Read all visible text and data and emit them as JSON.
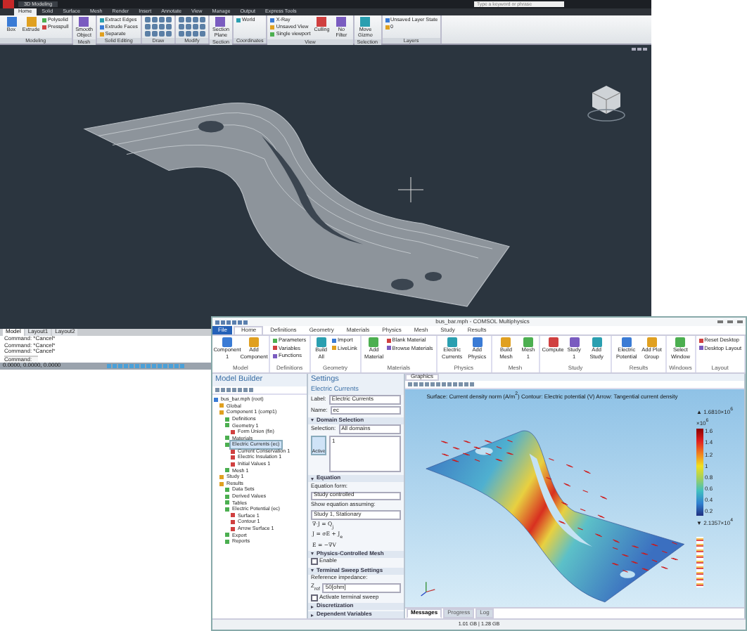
{
  "autocad": {
    "title": "3D Modeling",
    "search_placeholder": "Type a keyword or phrase",
    "tabs": [
      {
        "label": "Home",
        "selected": true
      },
      {
        "label": "Solid",
        "selected": false
      },
      {
        "label": "Surface",
        "selected": false
      },
      {
        "label": "Mesh",
        "selected": false
      },
      {
        "label": "Render",
        "selected": false
      },
      {
        "label": "Insert",
        "selected": false
      },
      {
        "label": "Annotate",
        "selected": false
      },
      {
        "label": "View",
        "selected": false
      },
      {
        "label": "Manage",
        "selected": false
      },
      {
        "label": "Output",
        "selected": false
      },
      {
        "label": "Express Tools",
        "selected": false
      }
    ],
    "panels": [
      {
        "label": "Modeling",
        "tools": [
          {
            "kind": "large",
            "label": "Box"
          },
          {
            "kind": "large",
            "label": "Extrude"
          },
          {
            "kind": "small",
            "label": "Polysolid"
          },
          {
            "kind": "small",
            "label": "Presspull"
          }
        ]
      },
      {
        "label": "Mesh",
        "tools": [
          {
            "kind": "large",
            "label": "Smooth Object"
          }
        ]
      },
      {
        "label": "Solid Editing",
        "tools": [
          {
            "kind": "small",
            "label": "Extract Edges"
          },
          {
            "kind": "small",
            "label": "Extrude Faces"
          },
          {
            "kind": "small",
            "label": "Separate"
          }
        ]
      },
      {
        "label": "Draw",
        "tools": [
          {
            "kind": "grid"
          }
        ]
      },
      {
        "label": "Modify",
        "tools": [
          {
            "kind": "grid"
          }
        ]
      },
      {
        "label": "Section",
        "tools": [
          {
            "kind": "large",
            "label": "Section Plane"
          }
        ]
      },
      {
        "label": "Coordinates",
        "tools": [
          {
            "kind": "small",
            "label": "World"
          }
        ]
      },
      {
        "label": "View",
        "tools": [
          {
            "kind": "small",
            "label": "X-Ray"
          },
          {
            "kind": "small",
            "label": "Unsaved View"
          },
          {
            "kind": "small",
            "label": "Single viewport"
          },
          {
            "kind": "large",
            "label": "Culling"
          },
          {
            "kind": "large",
            "label": "No Filter"
          }
        ]
      },
      {
        "label": "Selection",
        "tools": [
          {
            "kind": "large",
            "label": "Move Gizmo"
          }
        ]
      },
      {
        "label": "Layers",
        "tools": [
          {
            "kind": "small",
            "label": "Unsaved Layer State"
          },
          {
            "kind": "small",
            "label": "0"
          }
        ]
      }
    ],
    "layout_tabs": [
      {
        "label": "Model",
        "selected": true
      },
      {
        "label": "Layout1",
        "selected": false
      },
      {
        "label": "Layout2",
        "selected": false
      }
    ],
    "command_history": [
      "Command: *Cancel*",
      "Command: *Cancel*",
      "Command: *Cancel*"
    ],
    "command_prompt": "Command:",
    "coordinates": "0.0000, 0.0000, 0.0000"
  },
  "comsol": {
    "title": "bus_bar.mph - COMSOL Multiphysics",
    "tabs": [
      {
        "label": "File",
        "kind": "file",
        "selected": false
      },
      {
        "label": "Home",
        "kind": "tab",
        "selected": true
      },
      {
        "label": "Definitions",
        "kind": "tab",
        "selected": false
      },
      {
        "label": "Geometry",
        "kind": "tab",
        "selected": false
      },
      {
        "label": "Materials",
        "kind": "tab",
        "selected": false
      },
      {
        "label": "Physics",
        "kind": "tab",
        "selected": false
      },
      {
        "label": "Mesh",
        "kind": "tab",
        "selected": false
      },
      {
        "label": "Study",
        "kind": "tab",
        "selected": false
      },
      {
        "label": "Results",
        "kind": "tab",
        "selected": false
      }
    ],
    "ribbon_groups": [
      {
        "label": "Model",
        "tools": [
          {
            "kind": "large",
            "label": "Component 1"
          },
          {
            "kind": "large",
            "label": "Add Component"
          }
        ]
      },
      {
        "label": "Definitions",
        "tools": [
          {
            "kind": "small",
            "label": "Parameters"
          },
          {
            "kind": "small",
            "label": "Variables"
          },
          {
            "kind": "small",
            "label": "Functions"
          }
        ]
      },
      {
        "label": "Geometry",
        "tools": [
          {
            "kind": "large",
            "label": "Build All"
          },
          {
            "kind": "small",
            "label": "Import"
          },
          {
            "kind": "small",
            "label": "LiveLink"
          }
        ]
      },
      {
        "label": "Materials",
        "tools": [
          {
            "kind": "large",
            "label": "Add Material"
          },
          {
            "kind": "small",
            "label": "Blank Material"
          },
          {
            "kind": "small",
            "label": "Browse Materials"
          }
        ]
      },
      {
        "label": "Physics",
        "tools": [
          {
            "kind": "large",
            "label": "Electric Currents"
          },
          {
            "kind": "large",
            "label": "Add Physics"
          }
        ]
      },
      {
        "label": "Mesh",
        "tools": [
          {
            "kind": "large",
            "label": "Build Mesh"
          },
          {
            "kind": "large",
            "label": "Mesh 1"
          }
        ]
      },
      {
        "label": "Study",
        "tools": [
          {
            "kind": "large",
            "label": "Compute"
          },
          {
            "kind": "large",
            "label": "Study 1"
          },
          {
            "kind": "large",
            "label": "Add Study"
          }
        ]
      },
      {
        "label": "Results",
        "tools": [
          {
            "kind": "large",
            "label": "Electric Potential"
          },
          {
            "kind": "large",
            "label": "Add Plot Group"
          }
        ]
      },
      {
        "label": "Windows",
        "tools": [
          {
            "kind": "large",
            "label": "Select Window"
          }
        ]
      },
      {
        "label": "Layout",
        "tools": [
          {
            "kind": "small",
            "label": "Reset Desktop"
          },
          {
            "kind": "small",
            "label": "Desktop Layout"
          }
        ]
      }
    ],
    "model_builder": {
      "title": "Model Builder",
      "tree": [
        {
          "label": "bus_bar.mph (root)",
          "children": [
            {
              "label": "Global"
            },
            {
              "label": "Component 1 (comp1)",
              "children": [
                {
                  "label": "Definitions"
                },
                {
                  "label": "Geometry 1",
                  "children": [
                    {
                      "label": "Form Union (fin)"
                    }
                  ]
                },
                {
                  "label": "Materials"
                },
                {
                  "label": "Electric Currents (ec)",
                  "selected": true,
                  "children": [
                    {
                      "label": "Current Conservation 1"
                    },
                    {
                      "label": "Electric Insulation 1"
                    },
                    {
                      "label": "Initial Values 1"
                    }
                  ]
                },
                {
                  "label": "Mesh 1"
                }
              ]
            },
            {
              "label": "Study 1"
            },
            {
              "label": "Results",
              "children": [
                {
                  "label": "Data Sets"
                },
                {
                  "label": "Derived Values"
                },
                {
                  "label": "Tables"
                },
                {
                  "label": "Electric Potential (ec)",
                  "children": [
                    {
                      "label": "Surface 1"
                    },
                    {
                      "label": "Contour 1"
                    },
                    {
                      "label": "Arrow Surface 1"
                    }
                  ]
                },
                {
                  "label": "Export"
                },
                {
                  "label": "Reports"
                }
              ]
            }
          ]
        }
      ]
    },
    "settings": {
      "title": "Settings",
      "subtitle": "Electric Currents",
      "label_caption": "Label:",
      "label_value": "Electric Currents",
      "name_caption": "Name:",
      "name_value": "ec",
      "sections": [
        {
          "title": "Domain Selection",
          "expanded": true,
          "rows": [
            {
              "kind": "select",
              "caption": "Selection:",
              "value": "All domains"
            },
            {
              "kind": "list",
              "caption": "Active",
              "value": "1"
            }
          ]
        },
        {
          "title": "Equation",
          "expanded": true,
          "rows": [
            {
              "kind": "caption",
              "text": "Equation form:"
            },
            {
              "kind": "select",
              "value": "Study controlled"
            },
            {
              "kind": "caption",
              "text": "Show equation assuming:"
            },
            {
              "kind": "select",
              "value": "Study 1, Stationary"
            },
            {
              "kind": "equation",
              "text": "∇·J = Q$_{j}$"
            },
            {
              "kind": "equation",
              "text": "J = σE + J$_{e}$"
            },
            {
              "kind": "equation",
              "text": "E = −∇V"
            }
          ]
        },
        {
          "title": "Physics-Controlled Mesh",
          "expanded": true,
          "rows": [
            {
              "kind": "checkbox",
              "text": "Enable",
              "checked": false
            }
          ]
        },
        {
          "title": "Terminal Sweep Settings",
          "expanded": true,
          "rows": [
            {
              "kind": "caption",
              "text": "Reference impedance:"
            },
            {
              "kind": "input",
              "caption": "Z$_{ref}$",
              "value": "50[ohm]"
            },
            {
              "kind": "checkbox",
              "text": "Activate terminal sweep",
              "checked": false
            }
          ]
        },
        {
          "title": "Discretization",
          "expanded": false
        },
        {
          "title": "Dependent Variables",
          "expanded": false
        }
      ]
    },
    "graphics": {
      "tabs": [
        {
          "label": "Graphics",
          "selected": true
        }
      ],
      "plot_title": "Surface: Current density norm (A/m$^{2}$) Contour: Electric potential (V) Arrow: Tangential current density",
      "colorbar_max": "▲ 1.6810×10$^{6}$",
      "colorbar_unit": "×10$^{6}$",
      "colorbar_ticks": [
        "1.6",
        "1.4",
        "1.2",
        "1",
        "0.8",
        "0.6",
        "0.4",
        "0.2"
      ],
      "colorbar_min": "▼ 2.1357×10$^{4}$"
    },
    "bottom_tabs": [
      {
        "label": "Messages",
        "selected": true
      },
      {
        "label": "Progress",
        "selected": false
      },
      {
        "label": "Log",
        "selected": false
      }
    ],
    "status": "1.01 GB | 1.28 GB"
  }
}
